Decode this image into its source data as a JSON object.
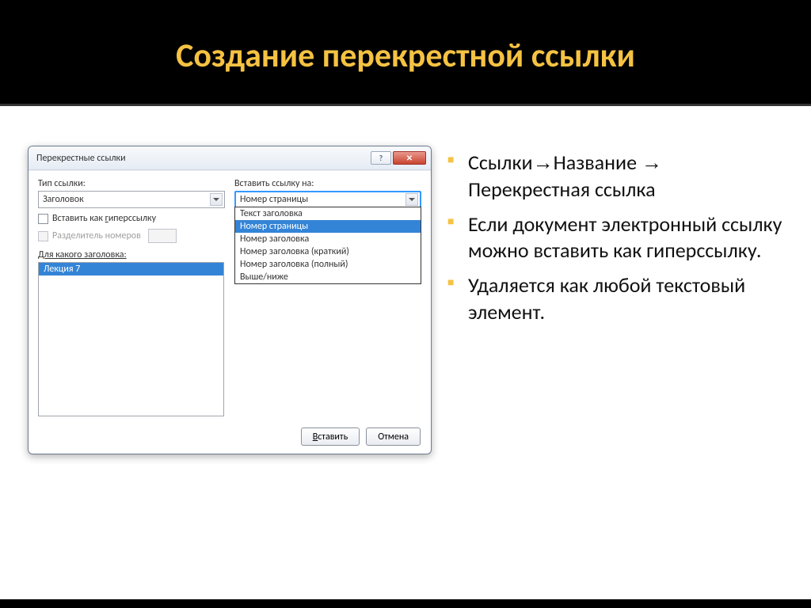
{
  "slide": {
    "title": "Создание перекрестной ссылки"
  },
  "dialog": {
    "title": "Перекрестные ссылки",
    "link_type_label": "Тип ссылки:",
    "link_type_value": "Заголовок",
    "insert_on_label": "Вставить ссылку на:",
    "insert_on_value": "Номер страницы",
    "hyperlink_checkbox": "Вставить как гиперссылку",
    "separator_checkbox": "Разделитель номеров",
    "for_heading_label": "Для какого заголовка:",
    "heading_item": "Лекция 7",
    "dropdown_options": [
      "Текст заголовка",
      "Номер страницы",
      "Номер заголовка",
      "Номер заголовка (краткий)",
      "Номер заголовка (полный)",
      "Выше/ниже"
    ],
    "insert_btn_prefix": "В",
    "insert_btn_rest": "ставить",
    "cancel_btn": "Отмена"
  },
  "bullets": {
    "item1_part1": "Ссылки",
    "item1_part2": "Название",
    "item1_part3": " Перекрестная ссылка",
    "item2": "Если документ электронный ссылку можно вставить как гиперссылку.",
    "item3": "Удаляется как любой текстовый элемент."
  },
  "arrow": "→"
}
